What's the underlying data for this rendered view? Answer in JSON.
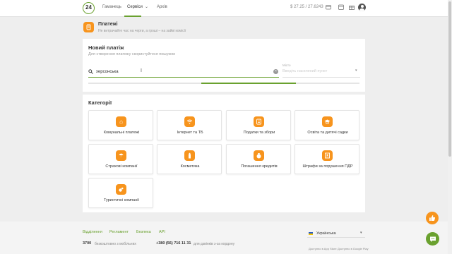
{
  "logo": {
    "text": "24"
  },
  "nav": {
    "wallet": "Гаманець",
    "services": "Сервіси",
    "archive": "Архів",
    "rates": "$  27.25 / 27.6243"
  },
  "page_header": {
    "title": "Платежі",
    "subtitle": "Не витрачайте час на черги, а гроші – на зайві комісії"
  },
  "new_payment": {
    "title": "Новий платіж",
    "subtitle": "Для створення платежу скористуйтеся пошуком",
    "search_value": "херсонська",
    "city_label": "Місто",
    "city_placeholder": "Введіть населений пункт",
    "progress": 0.35
  },
  "categories": {
    "title": "Категорії",
    "items": [
      {
        "label": "Комунальні платежі",
        "icon": "house-icon"
      },
      {
        "label": "Інтернет та ТБ",
        "icon": "wifi-icon"
      },
      {
        "label": "Податки та збори",
        "icon": "tax-icon"
      },
      {
        "label": "Освіта та дитячі садки",
        "icon": "graduation-cap-icon"
      },
      {
        "label": "Страхові компанії",
        "icon": "umbrella-icon"
      },
      {
        "label": "Косметика",
        "icon": "cosmetics-icon"
      },
      {
        "label": "Погашення кредитів",
        "icon": "money-bag-icon"
      },
      {
        "label": "Штрафи за порушення ПДР",
        "icon": "fine-icon"
      },
      {
        "label": "Туристичні компанії",
        "icon": "travel-icon"
      }
    ]
  },
  "footer": {
    "links": [
      "Відділення",
      "Регламент",
      "Безпека",
      "API"
    ],
    "short_number": "3700",
    "short_number_text": "безкоштовно з мобільних",
    "phone": "+380 (56) 716 11 31",
    "phone_text": "для дзвінків з-за кордону",
    "language": "Українська",
    "app_store": "Доступно в App Store",
    "google_play": "Доступно в Google Play"
  },
  "colors": {
    "accent": "#6aa12f",
    "orange": "#f7941d"
  }
}
